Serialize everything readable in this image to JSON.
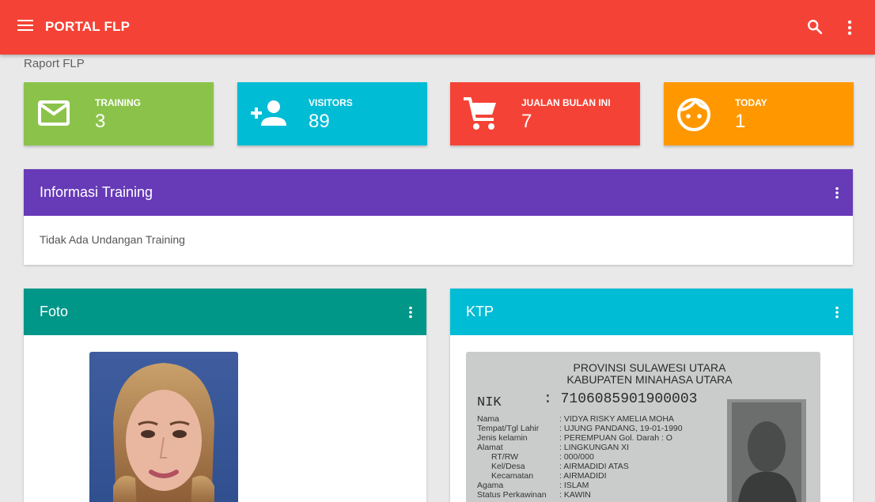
{
  "app": {
    "title": "PORTAL FLP"
  },
  "breadcrumb": "Raport FLP",
  "stats": [
    {
      "label": "TRAINING",
      "value": "3",
      "icon": "mail-icon",
      "color": "#8bc34a"
    },
    {
      "label": "VISITORS",
      "value": "89",
      "icon": "person-add-icon",
      "color": "#00bcd4"
    },
    {
      "label": "JUALAN BULAN INI",
      "value": "7",
      "icon": "cart-icon",
      "color": "#f44336"
    },
    {
      "label": "TODAY",
      "value": "1",
      "icon": "face-icon",
      "color": "#ff9800"
    }
  ],
  "training": {
    "title": "Informasi Training",
    "message": "Tidak Ada Undangan Training",
    "color": "#673ab7"
  },
  "foto": {
    "title": "Foto",
    "color": "#009688"
  },
  "ktp": {
    "title": "KTP",
    "color": "#00bcd4",
    "card": {
      "province": "PROVINSI SULAWESI UTARA",
      "regency": "KABUPATEN MINAHASA UTARA",
      "nik_label": "NIK",
      "nik": ": 7106085901900003",
      "fields": [
        {
          "label": "Nama",
          "value": ": VIDYA RISKY AMELIA MOHA"
        },
        {
          "label": "Tempat/Tgl Lahir",
          "value": ": UJUNG PANDANG, 19-01-1990"
        },
        {
          "label": "Jenis kelamin",
          "value": ": PEREMPUAN     Gol. Darah : O"
        },
        {
          "label": "Alamat",
          "value": ": LINGKUNGAN XI"
        },
        {
          "label": "RT/RW",
          "value": ": 000/000"
        },
        {
          "label": "Kel/Desa",
          "value": ": AIRMADIDI ATAS"
        },
        {
          "label": "Kecamatan",
          "value": ": AIRMADIDI"
        },
        {
          "label": "Agama",
          "value": ": ISLAM"
        },
        {
          "label": "Status Perkawinan",
          "value": ": KAWIN"
        }
      ]
    }
  }
}
